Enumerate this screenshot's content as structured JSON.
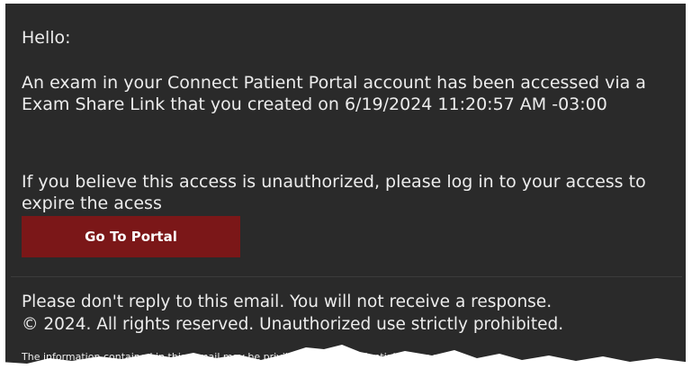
{
  "email": {
    "greeting": "Hello:",
    "message": "An exam in your Connect Patient Portal account has been accessed via a Exam Share Link that you created on 6/19/2024 11:20:57 AM -03:00",
    "unauthorized_notice": "If you believe this access is unauthorized, please log in to your access to expire the acess",
    "portal_button_label": "Go To Portal",
    "footer": {
      "no_reply": "Please don't reply to this email. You will not receive a response.",
      "copyright": "© 2024. All rights reserved. Unauthorized use strictly prohibited."
    },
    "disclaimer": "The information contained in this e-mail may be privileged and confidential. If you are"
  },
  "colors": {
    "background": "#2a2a2a",
    "text": "#ececec",
    "button": "#7b1718"
  }
}
